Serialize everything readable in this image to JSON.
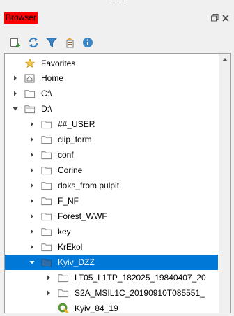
{
  "panel": {
    "title": "Browser"
  },
  "toolbar": {
    "icons": [
      "add-layer-icon",
      "refresh-icon",
      "filter-icon",
      "collapse-all-icon",
      "info-icon"
    ]
  },
  "tree": {
    "items": [
      {
        "label": "Favorites"
      },
      {
        "label": "Home"
      },
      {
        "label": "C:\\"
      },
      {
        "label": "D:\\"
      },
      {
        "label": "##_USER"
      },
      {
        "label": "clip_form"
      },
      {
        "label": "conf"
      },
      {
        "label": "Corine"
      },
      {
        "label": "doks_from pulpit"
      },
      {
        "label": "F_NF"
      },
      {
        "label": "Forest_WWF"
      },
      {
        "label": "key"
      },
      {
        "label": "KrEkol"
      },
      {
        "label": "Kyiv_DZZ"
      },
      {
        "label": "LT05_L1TP_182025_19840407_20"
      },
      {
        "label": "S2A_MSIL1C_20190910T085551_"
      },
      {
        "label": "Kyiv_84_19"
      }
    ]
  },
  "colors": {
    "title_bg": "#ff0000",
    "selection": "#0078d7",
    "folder": "#8c8c8c"
  }
}
